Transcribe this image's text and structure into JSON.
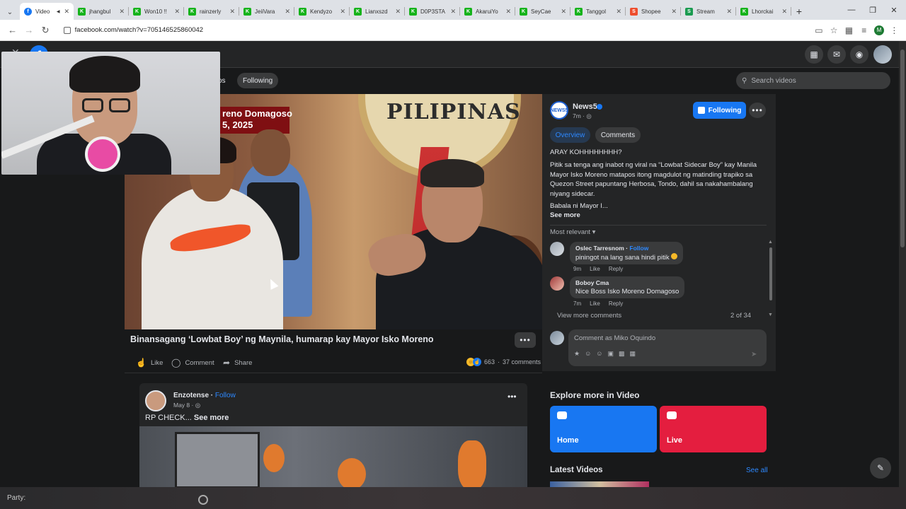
{
  "browser": {
    "tabs": [
      {
        "label": "Video",
        "icon": "facebook-icon",
        "active": true
      },
      {
        "label": "jhangbul",
        "icon": "kick-icon"
      },
      {
        "label": "Won10 !!",
        "icon": "kick-icon"
      },
      {
        "label": "rainzerly",
        "icon": "kick-icon"
      },
      {
        "label": "JeiiVara",
        "icon": "kick-icon"
      },
      {
        "label": "Kendyzo",
        "icon": "kick-icon"
      },
      {
        "label": "Lianxszd",
        "icon": "kick-icon"
      },
      {
        "label": "D0P3STA",
        "icon": "kick-icon"
      },
      {
        "label": "AkaruiYo",
        "icon": "kick-icon"
      },
      {
        "label": "SeyCae",
        "icon": "kick-icon"
      },
      {
        "label": "Tanggol",
        "icon": "kick-icon"
      },
      {
        "label": "Shopee",
        "icon": "shopee-icon"
      },
      {
        "label": "Stream",
        "icon": "stream-icon"
      },
      {
        "label": "Lhorckai",
        "icon": "kick-icon"
      }
    ],
    "url": "facebook.com/watch?v=705146525860042",
    "profile_initial": "M"
  },
  "watch": {
    "tab_videos_partial": "os",
    "tab_following": "Following",
    "search_placeholder": "Search videos"
  },
  "video": {
    "overlay_line1": "reno Domagoso",
    "overlay_line2": "5, 2025",
    "seal_text": "PILIPINAS",
    "title": "Binansagang ‘Lowbat Boy’ ng Maynila, humarap kay Mayor Isko Moreno",
    "like": "Like",
    "comment": "Comment",
    "share": "Share",
    "reaction_count": "663",
    "comments_count": "37 comments"
  },
  "sidebar": {
    "page_name": "News5",
    "page_logo_text": "NEWS5",
    "time": "7m ·",
    "following_label": "Following",
    "tab_overview": "Overview",
    "tab_comments": "Comments",
    "desc_cut": "ARAY KOHHHHHHHH?",
    "description": "Pitik sa tenga ang inabot ng viral na “Lowbat Sidecar Boy” kay Manila Mayor Isko Moreno matapos itong magdulot ng matinding trapiko sa Quezon Street papuntang Herbosa, Tondo, dahil sa nakahambalang niyang sidecar.",
    "description2": "Babala ni Mayor I...",
    "see_more": "See more",
    "most_relevant": "Most relevant",
    "comments": [
      {
        "name": "Oslec Tarresnom",
        "follow": "Follow",
        "text": "piningot na lang sana hindi pitik",
        "time": "9m",
        "like": "Like",
        "reply": "Reply"
      },
      {
        "name": "Boboy Cma",
        "text_prefix": "Nice Boss ",
        "text_tag": "Isko Moreno Domagoso",
        "time": "7m",
        "like": "Like",
        "reply": "Reply"
      }
    ],
    "view_more": "View more comments",
    "count": "2 of 34",
    "input_placeholder": "Comment as Miko Oquindo"
  },
  "feed": {
    "author": "Enzotense",
    "follow": "Follow",
    "date": "May 8 ·",
    "text": "RP CHECK...",
    "see_more": "See more"
  },
  "explore": {
    "title": "Explore more in Video",
    "home": "Home",
    "live": "Live",
    "latest": "Latest Videos",
    "see_all": "See all",
    "home_color": "#1877f2",
    "live_color": "#e41e3f"
  },
  "overlay": {
    "party_label": "Party:"
  }
}
